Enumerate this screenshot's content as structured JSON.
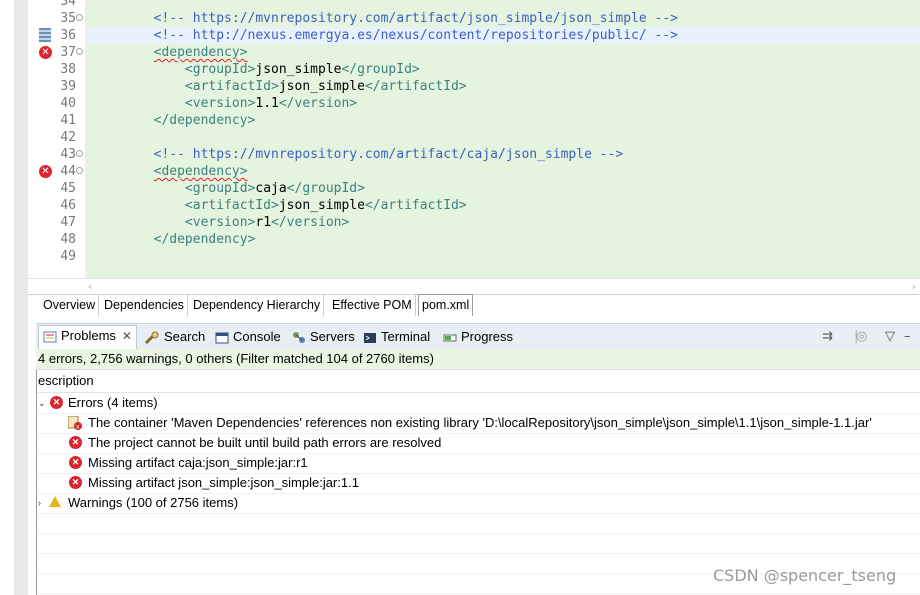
{
  "editor": {
    "lines": [
      {
        "num": "34",
        "tokens": [],
        "fold": false,
        "marker": ""
      },
      {
        "num": "35",
        "tokens": [
          {
            "t": "cm",
            "v": "        <!-- https://mvnrepository.com/artifact/json_simple/json_simple -->"
          }
        ],
        "fold": true,
        "marker": ""
      },
      {
        "num": "36",
        "tokens": [
          {
            "t": "cm",
            "v": "        <!-- http://nexus.emergya.es/nexus/content/repositories/public/ -->"
          }
        ],
        "fold": false,
        "marker": "selection",
        "highlight": true
      },
      {
        "num": "37",
        "tokens": [
          {
            "t": "tg",
            "v": "        "
          },
          {
            "t": "tg-sq",
            "v": "<dependency>"
          }
        ],
        "fold": true,
        "marker": "error"
      },
      {
        "num": "38",
        "tokens": [
          {
            "t": "tg",
            "v": "            <groupId>"
          },
          {
            "t": "tx",
            "v": "json_simple"
          },
          {
            "t": "tg",
            "v": "</groupId>"
          }
        ],
        "fold": false,
        "marker": ""
      },
      {
        "num": "39",
        "tokens": [
          {
            "t": "tg",
            "v": "            <artifactId>"
          },
          {
            "t": "tx",
            "v": "json_simple"
          },
          {
            "t": "tg",
            "v": "</artifactId>"
          }
        ],
        "fold": false,
        "marker": ""
      },
      {
        "num": "40",
        "tokens": [
          {
            "t": "tg",
            "v": "            <version>"
          },
          {
            "t": "tx",
            "v": "1.1"
          },
          {
            "t": "tg",
            "v": "</version>"
          }
        ],
        "fold": false,
        "marker": ""
      },
      {
        "num": "41",
        "tokens": [
          {
            "t": "tg",
            "v": "        </dependency>"
          }
        ],
        "fold": false,
        "marker": ""
      },
      {
        "num": "42",
        "tokens": [],
        "fold": false,
        "marker": ""
      },
      {
        "num": "43",
        "tokens": [
          {
            "t": "cm",
            "v": "        <!-- https://mvnrepository.com/artifact/caja/json_simple -->"
          }
        ],
        "fold": true,
        "marker": ""
      },
      {
        "num": "44",
        "tokens": [
          {
            "t": "tg",
            "v": "        "
          },
          {
            "t": "tg-sq",
            "v": "<dependency>"
          }
        ],
        "fold": true,
        "marker": "error"
      },
      {
        "num": "45",
        "tokens": [
          {
            "t": "tg",
            "v": "            <groupId>"
          },
          {
            "t": "tx",
            "v": "caja"
          },
          {
            "t": "tg",
            "v": "</groupId>"
          }
        ],
        "fold": false,
        "marker": ""
      },
      {
        "num": "46",
        "tokens": [
          {
            "t": "tg",
            "v": "            <artifactId>"
          },
          {
            "t": "tx",
            "v": "json_simple"
          },
          {
            "t": "tg",
            "v": "</artifactId>"
          }
        ],
        "fold": false,
        "marker": ""
      },
      {
        "num": "47",
        "tokens": [
          {
            "t": "tg",
            "v": "            <version>"
          },
          {
            "t": "tx",
            "v": "r1"
          },
          {
            "t": "tg",
            "v": "</version>"
          }
        ],
        "fold": false,
        "marker": ""
      },
      {
        "num": "48",
        "tokens": [
          {
            "t": "tg",
            "v": "        </dependency>"
          }
        ],
        "fold": false,
        "marker": ""
      },
      {
        "num": "49",
        "tokens": [],
        "fold": false,
        "marker": ""
      }
    ]
  },
  "editor_tabs": [
    {
      "label": "Overview"
    },
    {
      "label": "Dependencies"
    },
    {
      "label": "Dependency Hierarchy"
    },
    {
      "label": "Effective POM"
    },
    {
      "label": "pom.xml",
      "active": true
    }
  ],
  "view_tabs": [
    {
      "label": "Problems",
      "icon": "problems-icon",
      "active": true
    },
    {
      "label": "Search",
      "icon": "search-icon"
    },
    {
      "label": "Console",
      "icon": "console-icon"
    },
    {
      "label": "Servers",
      "icon": "servers-icon"
    },
    {
      "label": "Terminal",
      "icon": "terminal-icon"
    },
    {
      "label": "Progress",
      "icon": "progress-icon"
    }
  ],
  "problems": {
    "summary": "4 errors, 2,756 warnings, 0 others (Filter matched 104 of 2760 items)",
    "column_header": "escription",
    "errors_group": "Errors (4 items)",
    "error_items": [
      "The container 'Maven Dependencies' references non existing library 'D:\\localRepository\\json_simple\\json_simple\\1.1\\json_simple-1.1.jar'",
      "The project cannot be built until build path errors are resolved",
      "Missing artifact caja:json_simple:jar:r1",
      "Missing artifact json_simple:json_simple:jar:1.1"
    ],
    "warnings_group": "Warnings (100 of 2756 items)"
  },
  "watermark": "CSDN @spencer_tseng",
  "colors": {
    "error": "#d8262c",
    "warning": "#e6b31e",
    "comment": "#3f5fbf",
    "tag": "#3f7f7f"
  }
}
